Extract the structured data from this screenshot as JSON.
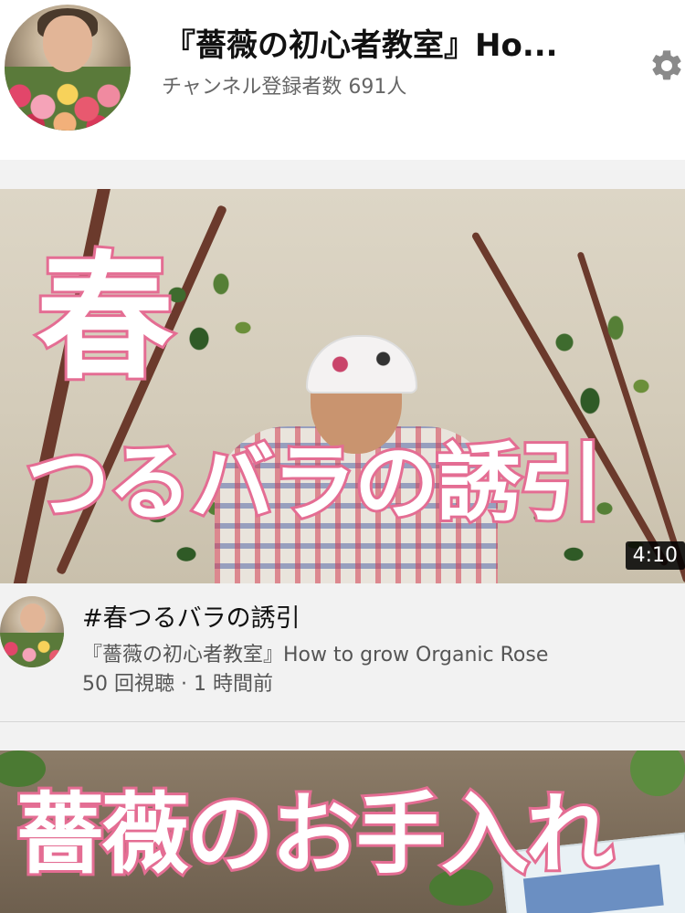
{
  "channel": {
    "title": "『薔薇の初心者教室』Ho...",
    "subscribers": "チャンネル登録者数 691人",
    "settings_icon": "gear-icon"
  },
  "video": {
    "thumbnail_text_1": "春",
    "thumbnail_text_2": "つるバラの誘引",
    "duration": "4:10",
    "title": "#春つるバラの誘引",
    "channel": "『薔薇の初心者教室』How to grow Organic Rose",
    "stats": "50 回視聴 · 1 時間前"
  },
  "next_video": {
    "thumbnail_text": "薔薇のお手入れ"
  },
  "colors": {
    "thumb_text_outline": "#e46d93",
    "background": "#f2f2f2"
  }
}
